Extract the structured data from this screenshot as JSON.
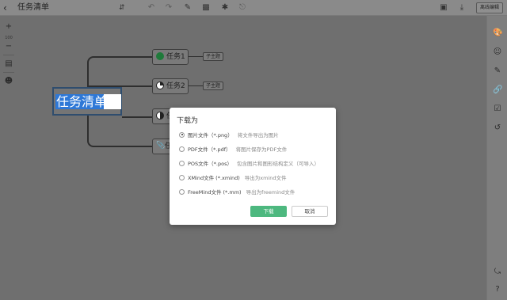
{
  "header": {
    "back_icon": "chevron-left-icon",
    "title": "任务清单",
    "offline_edit_label": "离线编辑"
  },
  "left_toolbar": {
    "zoom_in": "+",
    "zoom_level": "100",
    "zoom_out": "−"
  },
  "mindmap": {
    "root": "任务清单",
    "topics": [
      {
        "label": "任务1",
        "subtopic": "子主题",
        "icon_color": "#1f7a3a"
      },
      {
        "label": "任务2",
        "subtopic": "子主题",
        "icon_color": "#222222"
      },
      {
        "label": "任",
        "subtopic": ""
      },
      {
        "label": "任",
        "subtopic": ""
      }
    ]
  },
  "dialog": {
    "title": "下载为",
    "options": [
      {
        "label": "图片文件（*.png）",
        "desc": "将文件导出为图片",
        "checked": true
      },
      {
        "label": "PDF文件（*.pdf）",
        "desc": "将图片保存为PDF文件",
        "checked": false
      },
      {
        "label": "POS文件（*.pos）",
        "desc": "包含图片和图形结构定义（可导入）",
        "checked": false
      },
      {
        "label": "XMind文件 (*.xmind)",
        "desc": "导出为xmind文件",
        "checked": false
      },
      {
        "label": "FreeMind文件 (*.mm)",
        "desc": "导出为freemind文件",
        "checked": false
      }
    ],
    "ok_label": "下载",
    "cancel_label": "取消"
  }
}
